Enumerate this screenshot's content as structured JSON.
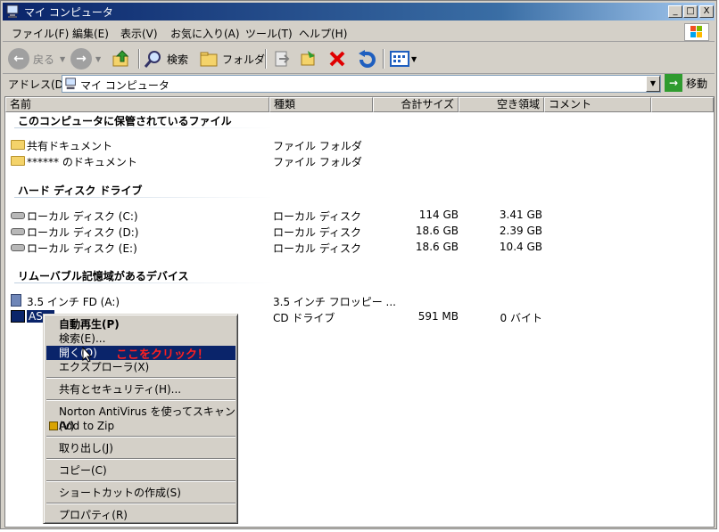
{
  "window": {
    "title": "マイ コンピュータ",
    "buttons": {
      "minimize": "_",
      "maximize": "□",
      "close": "X"
    }
  },
  "menubar": {
    "items": [
      "ファイル(F)",
      "編集(E)",
      "表示(V)",
      "お気に入り(A)",
      "ツール(T)",
      "ヘルプ(H)"
    ]
  },
  "toolbar": {
    "back_label": "戻る",
    "search_label": "検索",
    "folders_label": "フォルダ"
  },
  "address": {
    "label": "アドレス(D)",
    "value": "マイ コンピュータ",
    "go_label": "移動"
  },
  "list": {
    "columns": [
      "名前",
      "種類",
      "合計サイズ",
      "空き領域",
      "コメント"
    ],
    "groups": [
      {
        "title": "このコンピュータに保管されているファイル",
        "items": [
          {
            "name": "共有ドキュメント",
            "type": "ファイル フォルダ",
            "total": "",
            "free": "",
            "icon": "folder-icon"
          },
          {
            "name": "****** のドキュメント",
            "type": "ファイル フォルダ",
            "total": "",
            "free": "",
            "icon": "folder-icon"
          }
        ]
      },
      {
        "title": "ハード ディスク ドライブ",
        "items": [
          {
            "name": "ローカル ディスク (C:)",
            "type": "ローカル ディスク",
            "total": "114 GB",
            "free": "3.41 GB",
            "icon": "hard-drive-icon"
          },
          {
            "name": "ローカル ディスク (D:)",
            "type": "ローカル ディスク",
            "total": "18.6 GB",
            "free": "2.39 GB",
            "icon": "hard-drive-icon"
          },
          {
            "name": "ローカル ディスク (E:)",
            "type": "ローカル ディスク",
            "total": "18.6 GB",
            "free": "10.4 GB",
            "icon": "hard-drive-icon"
          }
        ]
      },
      {
        "title": "リムーバブル記憶域があるデバイス",
        "items": [
          {
            "name": "3.5 インチ FD (A:)",
            "type": "3.5 インチ フロッピー ...",
            "total": "",
            "free": "",
            "icon": "floppy-drive-icon"
          },
          {
            "name": "AS...",
            "type": "CD ドライブ",
            "total": "591 MB",
            "free": "0 バイト",
            "icon": "cd-drive-icon"
          }
        ]
      }
    ]
  },
  "context_menu": {
    "items": [
      {
        "label": "自動再生(P)",
        "bold": true
      },
      {
        "label": "検索(E)..."
      },
      {
        "label": "開く(O)",
        "highlighted": true
      },
      {
        "label": "エクスプローラ(X)"
      },
      {
        "label": "共有とセキュリティ(H)..."
      },
      {
        "label": "Norton AntiVirus を使ってスキャン(V)"
      },
      {
        "label": "Add to Zip"
      },
      {
        "label": "取り出し(J)"
      },
      {
        "label": "コピー(C)"
      },
      {
        "label": "ショートカットの作成(S)"
      },
      {
        "label": "プロパティ(R)"
      }
    ],
    "annotation": "ここをクリック！"
  },
  "colors": {
    "titlebar": "#0a246a",
    "highlight": "#0a246a",
    "annotation": "#ff2020"
  }
}
